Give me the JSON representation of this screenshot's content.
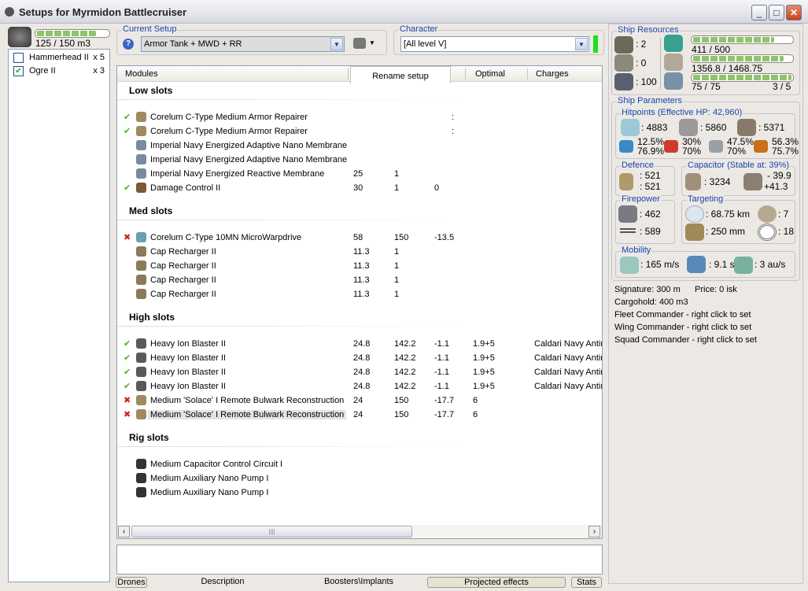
{
  "window": {
    "title": "Setups for Myrmidon Battlecruiser"
  },
  "drones": {
    "bay": "125 / 150 m3",
    "bay_fill": 0.83,
    "items": [
      {
        "name": "Hammerhead II",
        "qty": "x 5",
        "checked": false
      },
      {
        "name": "Ogre II",
        "qty": "x 3",
        "checked": true
      }
    ]
  },
  "setup": {
    "label": "Current Setup",
    "value": "Armor Tank + MWD + RR"
  },
  "character": {
    "label": "Character",
    "value": "[All level V]"
  },
  "columns": {
    "modules": "Modules",
    "rename": "Rename setup",
    "optimal": "Optimal",
    "charges": "Charges"
  },
  "sections": [
    {
      "title": "Low slots",
      "rows": [
        {
          "status": "ok",
          "name": "Corelum C-Type Medium Armor Repairer",
          "cols": [
            "",
            "",
            "",
            "",
            ""
          ],
          "icon": "armor-repairer",
          "color": "#a08a60"
        },
        {
          "status": "ok",
          "name": "Corelum C-Type Medium Armor Repairer",
          "cols": [
            "",
            "",
            "",
            "",
            ""
          ],
          "icon": "armor-repairer",
          "color": "#a08a60"
        },
        {
          "status": "",
          "name": "Imperial Navy Energized Adaptive Nano Membrane",
          "cols": [
            "",
            "",
            "",
            "",
            ""
          ],
          "icon": "membrane",
          "color": "#7a8aa0"
        },
        {
          "status": "",
          "name": "Imperial Navy Energized Adaptive Nano Membrane",
          "cols": [
            "",
            "",
            "",
            "",
            ""
          ],
          "icon": "membrane",
          "color": "#7a8aa0"
        },
        {
          "status": "",
          "name": "Imperial Navy Energized Reactive Membrane",
          "cols": [
            "25",
            "1",
            "",
            "",
            ""
          ],
          "icon": "membrane",
          "color": "#7a8aa0"
        },
        {
          "status": "ok",
          "name": "Damage Control II",
          "cols": [
            "30",
            "1",
            "0",
            "",
            ""
          ],
          "icon": "damage-control",
          "color": "#7a5a3a"
        }
      ]
    },
    {
      "title": "Med slots",
      "rows": [
        {
          "status": "off",
          "name": "Corelum C-Type 10MN MicroWarpdrive",
          "cols": [
            "58",
            "150",
            "-13.5",
            "",
            ""
          ],
          "icon": "microwarpdrive",
          "color": "#6aa0b0"
        },
        {
          "status": "",
          "name": "Cap Recharger II",
          "cols": [
            "11.3",
            "1",
            "",
            "",
            ""
          ],
          "icon": "cap-recharger",
          "color": "#8a7a5a"
        },
        {
          "status": "",
          "name": "Cap Recharger II",
          "cols": [
            "11.3",
            "1",
            "",
            "",
            ""
          ],
          "icon": "cap-recharger",
          "color": "#8a7a5a"
        },
        {
          "status": "",
          "name": "Cap Recharger II",
          "cols": [
            "11.3",
            "1",
            "",
            "",
            ""
          ],
          "icon": "cap-recharger",
          "color": "#8a7a5a"
        },
        {
          "status": "",
          "name": "Cap Recharger II",
          "cols": [
            "11.3",
            "1",
            "",
            "",
            ""
          ],
          "icon": "cap-recharger",
          "color": "#8a7a5a"
        }
      ]
    },
    {
      "title": "High slots",
      "rows": [
        {
          "status": "ok",
          "name": "Heavy Ion Blaster II",
          "cols": [
            "24.8",
            "142.2",
            "-1.1",
            "1.9+5",
            "Caldari Navy Antin"
          ],
          "icon": "blaster",
          "color": "#5a5a5a"
        },
        {
          "status": "ok",
          "name": "Heavy Ion Blaster II",
          "cols": [
            "24.8",
            "142.2",
            "-1.1",
            "1.9+5",
            "Caldari Navy Antin"
          ],
          "icon": "blaster",
          "color": "#5a5a5a"
        },
        {
          "status": "ok",
          "name": "Heavy Ion Blaster II",
          "cols": [
            "24.8",
            "142.2",
            "-1.1",
            "1.9+5",
            "Caldari Navy Antin"
          ],
          "icon": "blaster",
          "color": "#5a5a5a"
        },
        {
          "status": "ok",
          "name": "Heavy Ion Blaster II",
          "cols": [
            "24.8",
            "142.2",
            "-1.1",
            "1.9+5",
            "Caldari Navy Antin"
          ],
          "icon": "blaster",
          "color": "#5a5a5a"
        },
        {
          "status": "off",
          "name": "Medium 'Solace' I Remote Bulwark Reconstruction",
          "cols": [
            "24",
            "150",
            "-17.7",
            "6",
            ""
          ],
          "icon": "remote-armor-repairer",
          "color": "#a08a60"
        },
        {
          "status": "off",
          "name": "Medium 'Solace' I Remote Bulwark Reconstruction",
          "cols": [
            "24",
            "150",
            "-17.7",
            "6",
            ""
          ],
          "icon": "remote-armor-repairer",
          "color": "#a08a60",
          "selected": true
        }
      ]
    },
    {
      "title": "Rig slots",
      "rows": [
        {
          "status": "",
          "name": "Medium Capacitor Control Circuit I",
          "cols": [
            "",
            "",
            "",
            "",
            ""
          ],
          "icon": "rig",
          "color": "#333"
        },
        {
          "status": "",
          "name": "Medium Auxiliary Nano Pump I",
          "cols": [
            "",
            "",
            "",
            "",
            ""
          ],
          "icon": "rig",
          "color": "#333"
        },
        {
          "status": "",
          "name": "Medium Auxiliary Nano Pump I",
          "cols": [
            "",
            "",
            "",
            "",
            ""
          ],
          "icon": "rig",
          "color": "#333"
        }
      ]
    }
  ],
  "resources": {
    "label": "Ship Resources",
    "turrets": ": 2",
    "launchers": ": 0",
    "calibration": ": 100",
    "cpu": "411 / 500",
    "cpu_fill": 0.82,
    "powergrid": "1356.8 / 1468.75",
    "pg_fill": 0.92,
    "drone_bw": "75 / 75",
    "bw_fill": 1.0,
    "drones_active": "3 / 5"
  },
  "params": {
    "label": "Ship Parameters",
    "hp_label": "Hitpoints (Effective HP: 42,960)",
    "shield": ": 4883",
    "armor": ": 5860",
    "structure": ": 5371",
    "res": [
      {
        "top": "12.5%",
        "bot": "76.9%"
      },
      {
        "top": "30%",
        "bot": "70%"
      },
      {
        "top": "47.5%",
        "bot": "70%"
      },
      {
        "top": "56.3%",
        "bot": "75.7%"
      }
    ],
    "defence_label": "Defence",
    "def1": ": 521",
    "def2": ": 521",
    "cap_label": "Capacitor (Stable at: 39%)",
    "cap": ": 3234",
    "cap_use": "- 39.9",
    "cap_regen": "+41.3",
    "fire_label": "Firepower",
    "turret_dps": ": 462",
    "volley": ": 589",
    "target_label": "Targeting",
    "range": ": 68.75 km",
    "max_targets": ": 7",
    "scan": ": 250 mm",
    "sensor": ": 18",
    "mob_label": "Mobility",
    "speed": ": 165 m/s",
    "align": ": 9.1 s",
    "warp": ": 3 au/s",
    "signature": "Signature: 300 m",
    "price": "Price: 0 isk",
    "cargo": "Cargohold: 400 m3",
    "fleet": "Fleet Commander - right click to set",
    "wing": "Wing Commander - right click to set",
    "squad": "Squad Commander - right click to set"
  },
  "tabs": {
    "drones": "Drones",
    "description": "Description",
    "boosters": "Boosters\\Implants",
    "projected": "Projected effects",
    "stats": "Stats"
  },
  "colors": {
    "ok": "#4caf28",
    "off": "#d02020",
    "accent": "#1a44b0"
  }
}
